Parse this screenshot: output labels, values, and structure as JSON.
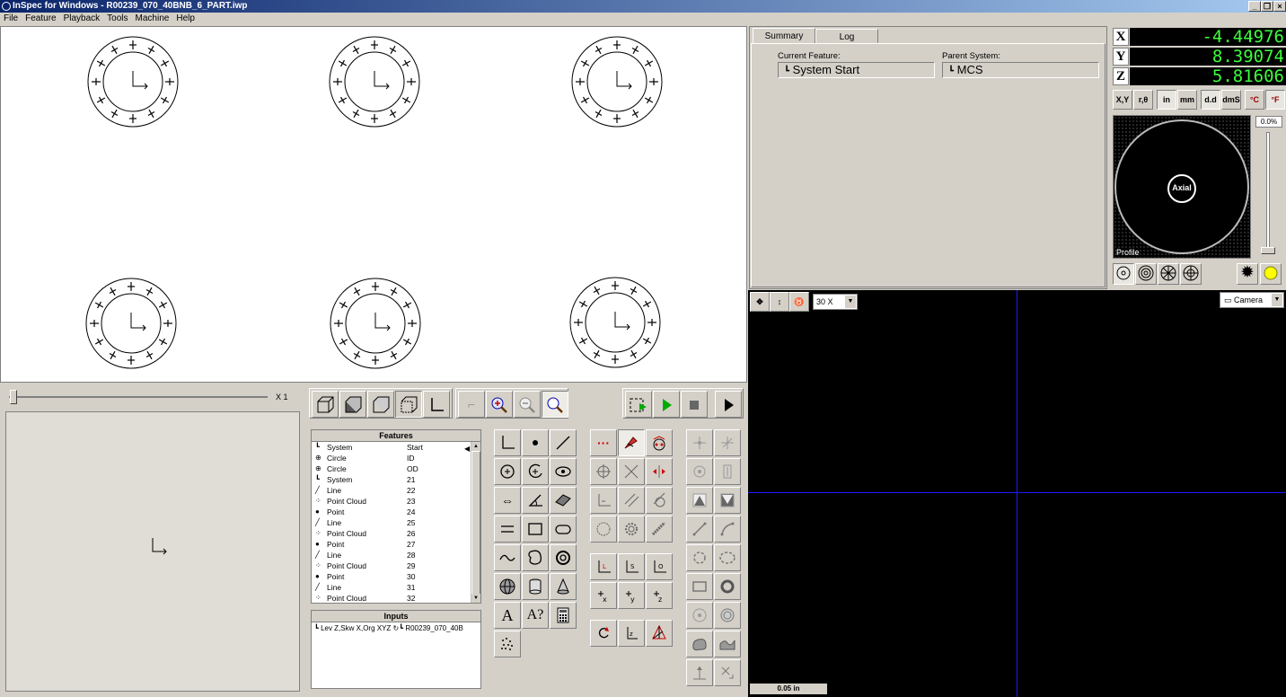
{
  "window": {
    "title": "InSpec for Windows - R00239_070_40BNB_6_PART.iwp",
    "min_label": "_",
    "restore_label": "❐",
    "close_label": "×"
  },
  "menu": [
    "File",
    "Feature",
    "Playback",
    "Tools",
    "Machine",
    "Help"
  ],
  "summary": {
    "tabs": [
      "Summary",
      "Log"
    ],
    "current_feature_label": "Current Feature:",
    "current_feature_value": "System Start",
    "parent_system_label": "Parent System:",
    "parent_system_value": "MCS"
  },
  "dro": {
    "x_label": "X",
    "x_value": "-4.44976",
    "y_label": "Y",
    "y_value": "8.39074",
    "z_label": "Z",
    "z_value": "5.81606",
    "mode_buttons": [
      "X,Y",
      "r,θ",
      "in",
      "mm",
      "d.d",
      "dmS",
      "°C",
      "°F"
    ]
  },
  "light": {
    "percent": "0.0%",
    "center_label": "Axial",
    "mode_label": "Profile"
  },
  "camera": {
    "zoom": "30 X",
    "source": "Camera",
    "scale_label": "0.05 in"
  },
  "slider": {
    "label": "X 1"
  },
  "features": {
    "header": "Features",
    "rows": [
      {
        "icon": "system-icon",
        "glyph": "┗",
        "name": "System",
        "value": "Start"
      },
      {
        "icon": "circle-icon",
        "glyph": "⊕",
        "name": "Circle",
        "value": "ID"
      },
      {
        "icon": "circle-icon",
        "glyph": "⊕",
        "name": "Circle",
        "value": "OD"
      },
      {
        "icon": "system-icon",
        "glyph": "┗",
        "name": "System",
        "value": "21"
      },
      {
        "icon": "line-icon",
        "glyph": "╱",
        "name": "Line",
        "value": "22"
      },
      {
        "icon": "point-cloud-icon",
        "glyph": "⁘",
        "name": "Point Cloud",
        "value": "23"
      },
      {
        "icon": "point-icon",
        "glyph": "●",
        "name": "Point",
        "value": "24"
      },
      {
        "icon": "line-icon",
        "glyph": "╱",
        "name": "Line",
        "value": "25"
      },
      {
        "icon": "point-cloud-icon",
        "glyph": "⁘",
        "name": "Point Cloud",
        "value": "26"
      },
      {
        "icon": "point-icon",
        "glyph": "●",
        "name": "Point",
        "value": "27"
      },
      {
        "icon": "line-icon",
        "glyph": "╱",
        "name": "Line",
        "value": "28"
      },
      {
        "icon": "point-cloud-icon",
        "glyph": "⁘",
        "name": "Point Cloud",
        "value": "29"
      },
      {
        "icon": "point-icon",
        "glyph": "●",
        "name": "Point",
        "value": "30"
      },
      {
        "icon": "line-icon",
        "glyph": "╱",
        "name": "Line",
        "value": "31"
      },
      {
        "icon": "point-cloud-icon",
        "glyph": "⁘",
        "name": "Point Cloud",
        "value": "32"
      }
    ]
  },
  "inputs": {
    "header": "Inputs",
    "row": "Lev Z,Skw X,Org XYZ",
    "row_target": "R00239_070_40B"
  },
  "feature_buttons": {
    "text_a": "A",
    "text_aq": "A?",
    "dots": "···"
  },
  "colors": {
    "dro_text": "#3cff3c",
    "crosshair": "#1a1aff",
    "title_gradient_start": "#0a246a"
  }
}
